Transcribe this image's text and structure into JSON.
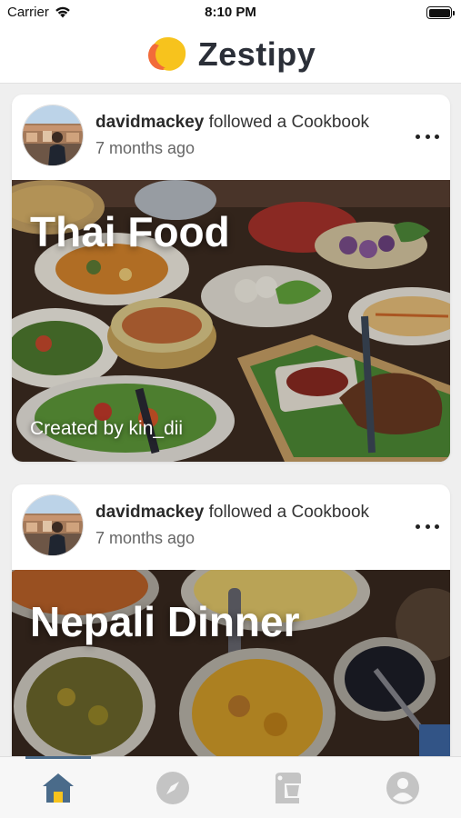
{
  "status_bar": {
    "carrier": "Carrier",
    "time": "8:10 PM",
    "battery_level": 1.0
  },
  "app": {
    "name": "Zestipy",
    "logo_colors": [
      "#f26b3a",
      "#f7c31d"
    ]
  },
  "feed": [
    {
      "user": "davidmackey",
      "action": "followed a Cookbook",
      "time_ago": "7 months ago",
      "cookbook_title": "Thai Food",
      "creator_text": "Created by kin_dii"
    },
    {
      "user": "davidmackey",
      "action": "followed a Cookbook",
      "time_ago": "7 months ago",
      "cookbook_title": "Nepali Dinner",
      "creator_text": ""
    }
  ],
  "tab_bar": {
    "active_tab": "home",
    "tabs": [
      {
        "id": "home",
        "icon": "home-icon"
      },
      {
        "id": "discover",
        "icon": "compass-icon"
      },
      {
        "id": "kitchen",
        "icon": "mixer-icon"
      },
      {
        "id": "profile",
        "icon": "profile-icon"
      }
    ],
    "active_color": "#4a6b8a",
    "inactive_color": "#c4c4c4"
  }
}
